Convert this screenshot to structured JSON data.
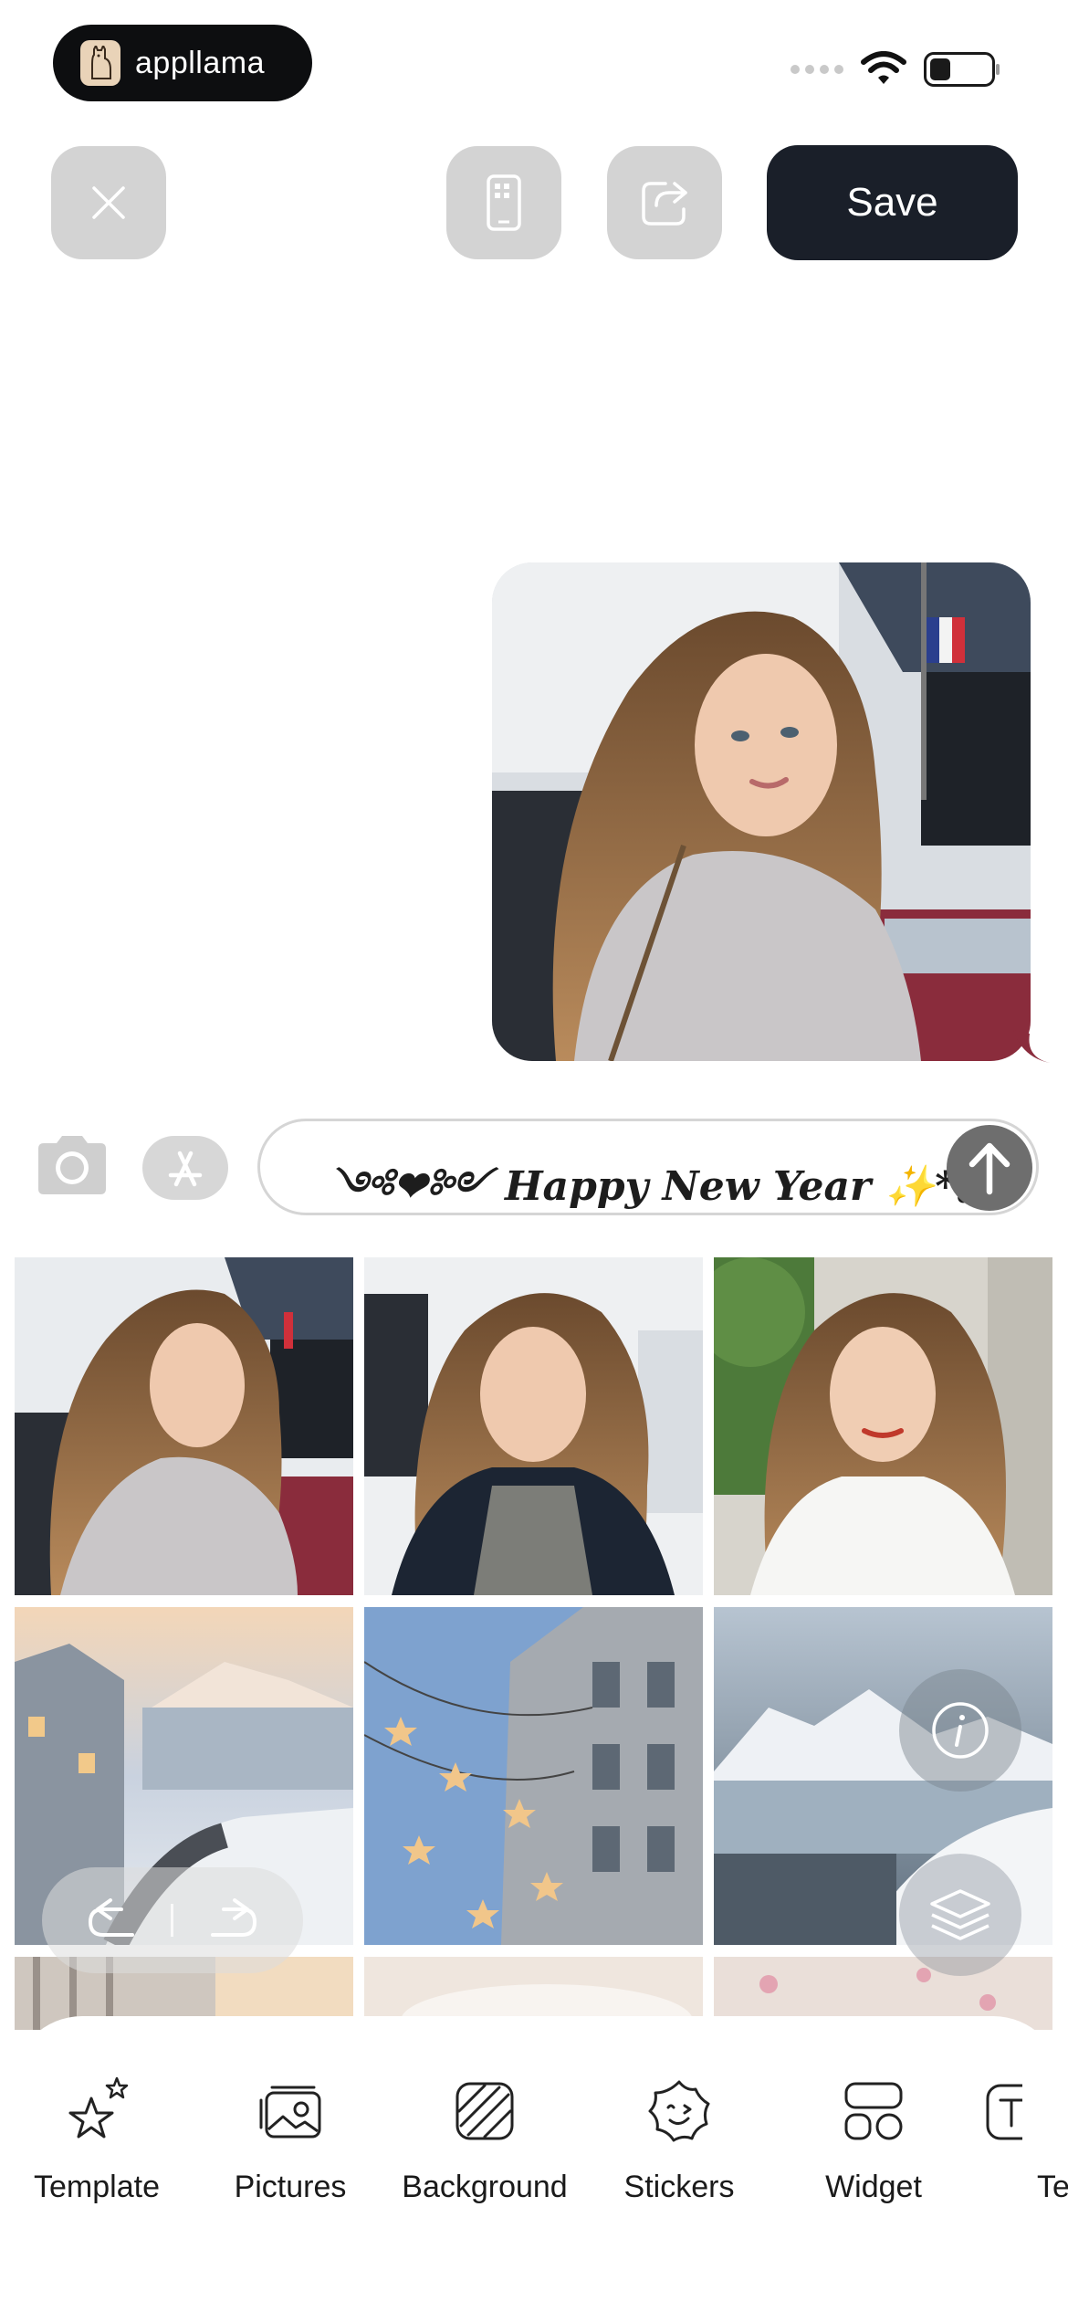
{
  "status_bar": {
    "brand_name": "appllama"
  },
  "toolbar": {
    "save_label": "Save"
  },
  "composer": {
    "message_text": "༺❤༻ Happy New Year ✨*。"
  },
  "icons": {
    "close": "close-icon",
    "device": "phone-device-icon",
    "share": "share-icon",
    "camera": "camera-icon",
    "appstore": "app-store-icon",
    "send": "arrow-up-icon",
    "info": "info-icon",
    "layers": "layers-icon",
    "undo": "undo-icon",
    "redo": "redo-icon"
  },
  "bottom_tabs": [
    {
      "label": "Template",
      "icon": "star-sparkle-icon"
    },
    {
      "label": "Pictures",
      "icon": "pictures-icon"
    },
    {
      "label": "Background",
      "icon": "background-icon"
    },
    {
      "label": "Stickers",
      "icon": "sticker-face-icon"
    },
    {
      "label": "Widget",
      "icon": "widget-icon"
    },
    {
      "label": "Te",
      "icon": "text-icon"
    }
  ],
  "colors": {
    "save_button": "#1a1f29",
    "control_gray": "#d3d3d3",
    "send_button": "#6e6e6e"
  }
}
